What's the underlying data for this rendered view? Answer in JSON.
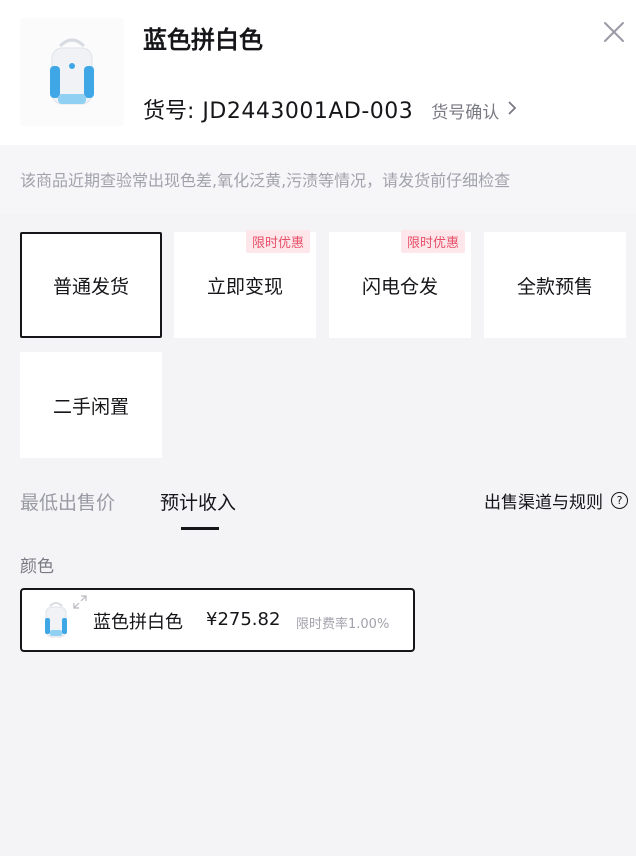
{
  "header": {
    "title": "蓝色拼白色",
    "sku_label": "货号:",
    "sku_value": "JD2443001AD-003",
    "sku_confirm": "货号确认"
  },
  "notice": "该商品近期查验常出现色差,氧化泛黄,污渍等情况，请发货前仔细检查",
  "options": [
    {
      "label": "普通发货",
      "badge": "",
      "selected": true
    },
    {
      "label": "立即变现",
      "badge": "限时优惠",
      "selected": false
    },
    {
      "label": "闪电仓发",
      "badge": "限时优惠",
      "selected": false
    },
    {
      "label": "全款预售",
      "badge": "",
      "selected": false
    },
    {
      "label": "二手闲置",
      "badge": "",
      "selected": false
    }
  ],
  "tabs": {
    "lowest": "最低出售价",
    "income": "预计收入",
    "active": "income",
    "rules": "出售渠道与规则"
  },
  "color_section": {
    "label": "颜色",
    "item": {
      "name": "蓝色拼白色",
      "price": "¥275.82",
      "fee": "限时费率1.00%"
    }
  },
  "icons": {
    "close": "close-icon",
    "chevron": "chevron-right-icon",
    "help": "question-circle-icon",
    "expand": "expand-icon",
    "product": "backpack-image"
  },
  "colors": {
    "text": "#16161a",
    "muted": "#a2a2ac",
    "badge_bg": "#fde7ea",
    "badge_text": "#e8506a",
    "product_blue": "#3fa7e6"
  }
}
